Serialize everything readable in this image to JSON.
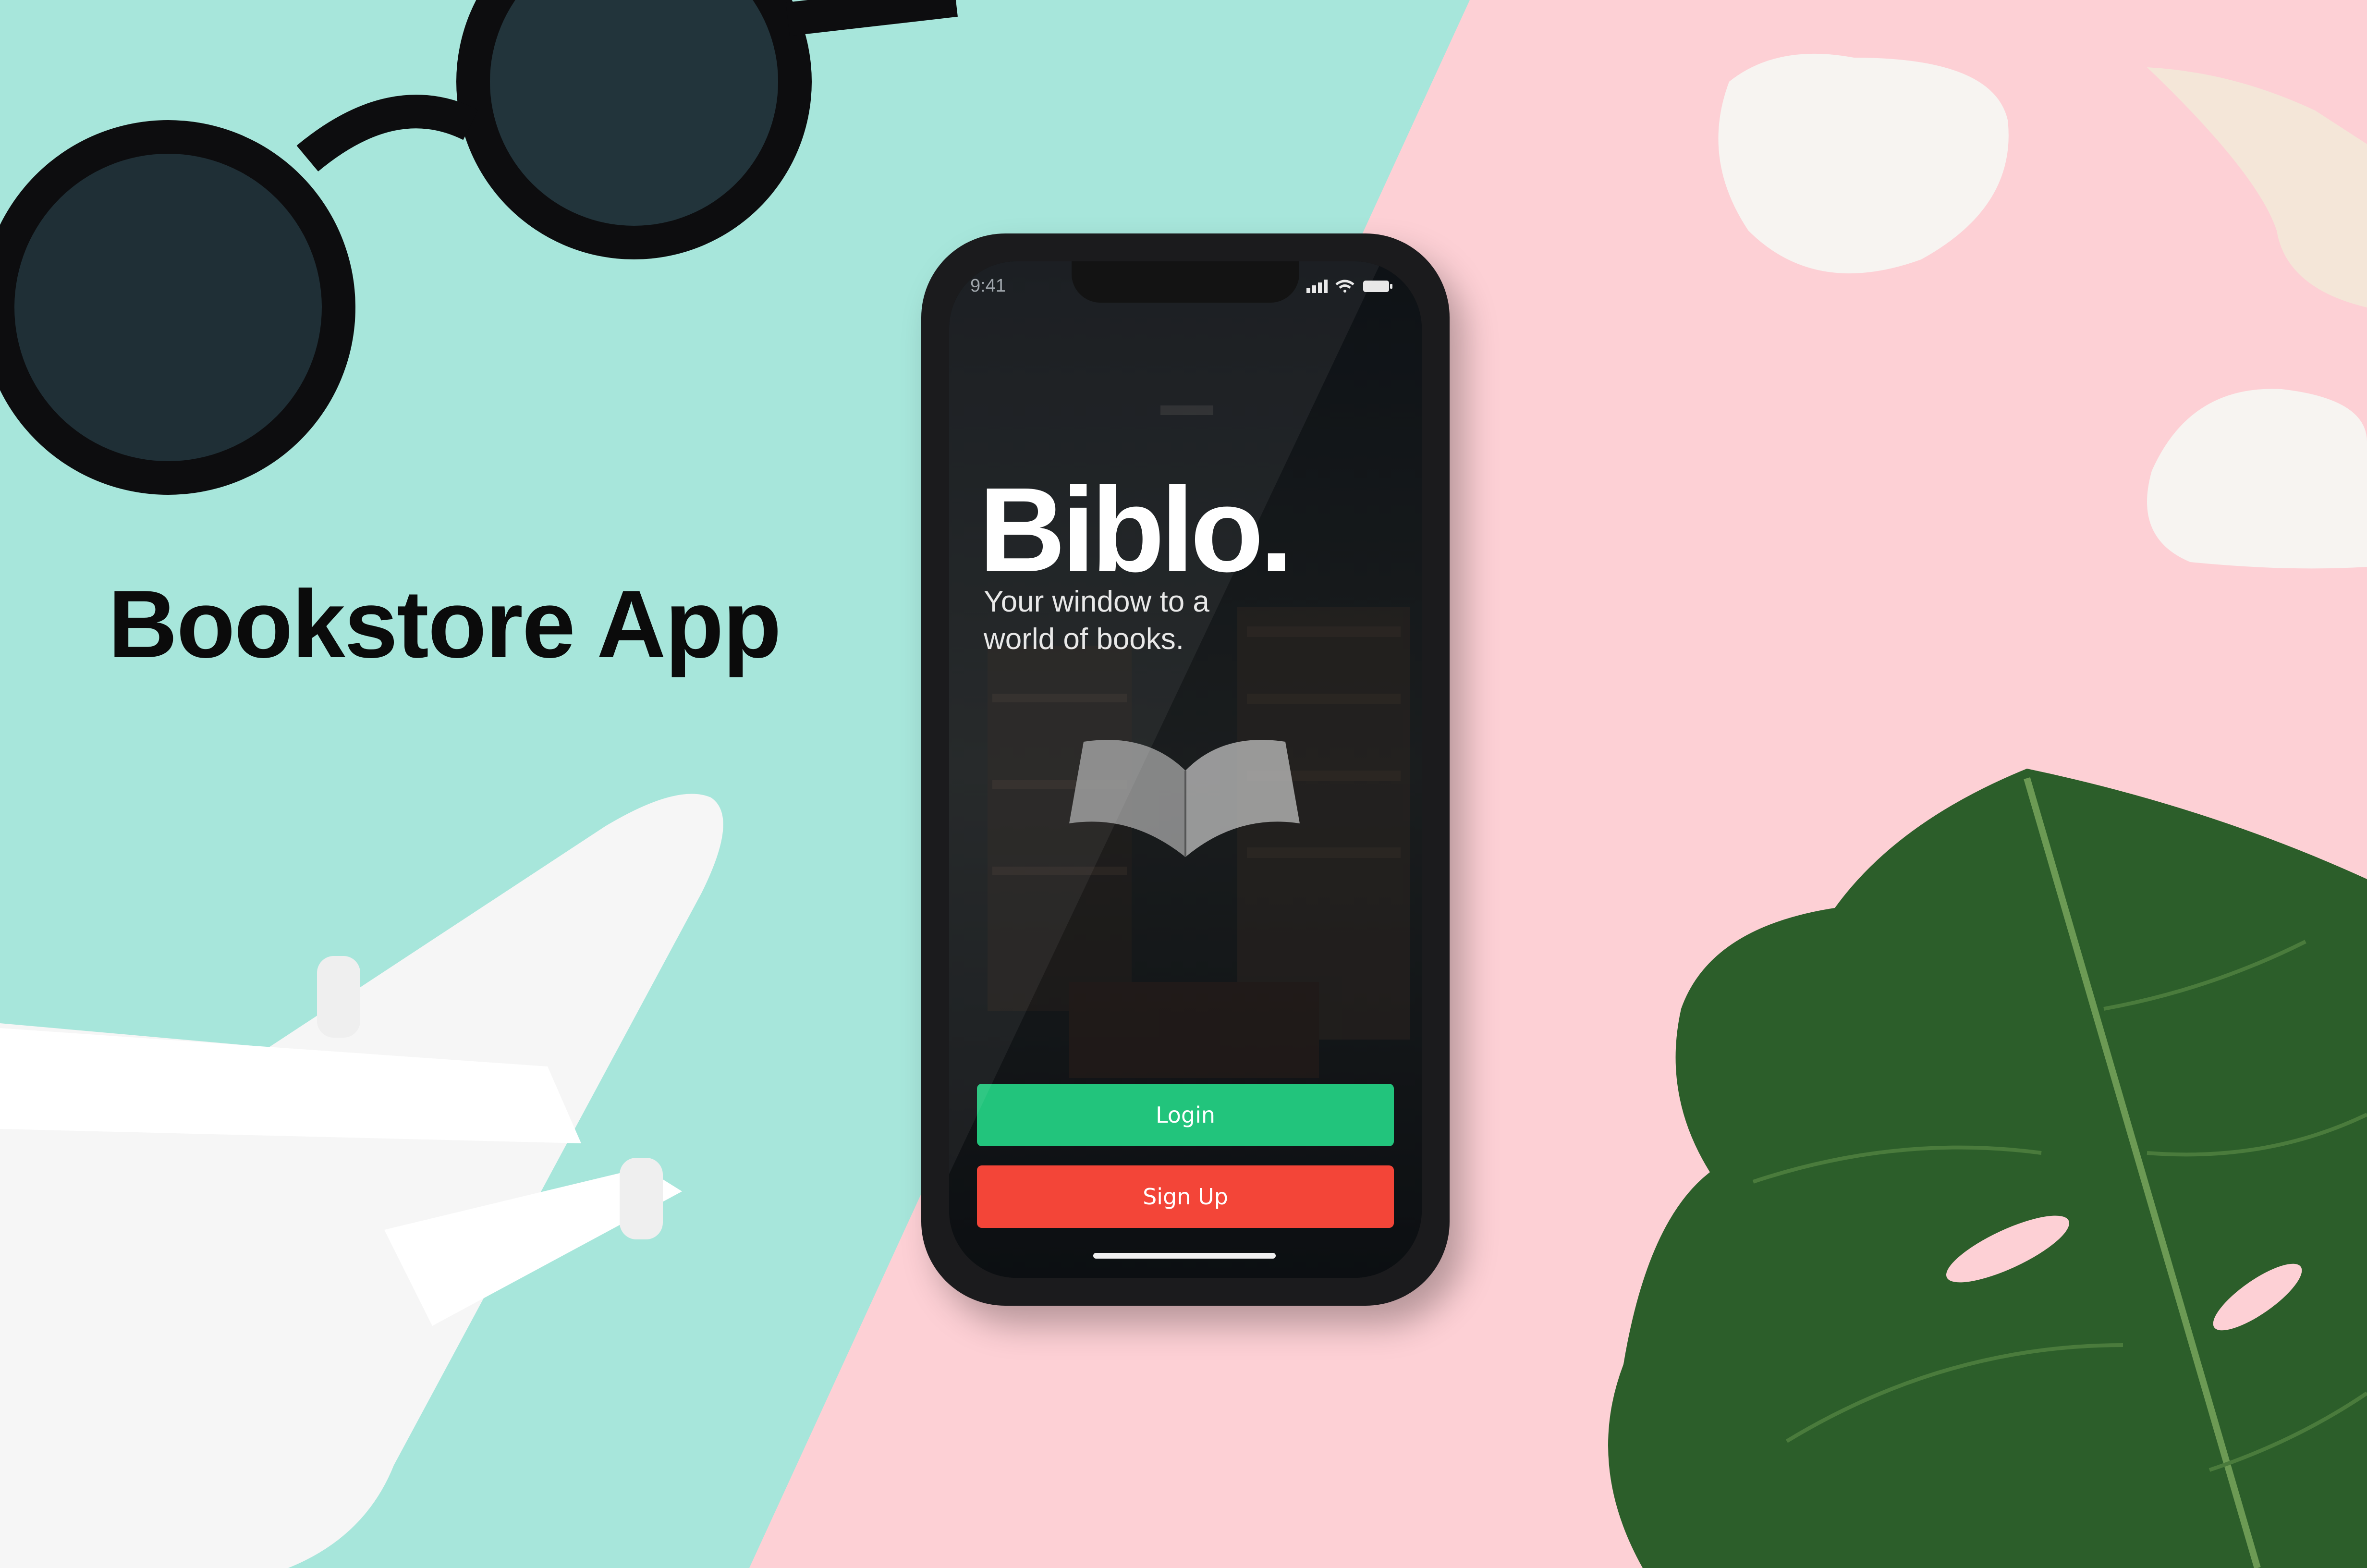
{
  "page": {
    "headline": "Bookstore App"
  },
  "app": {
    "status_time": "9:41",
    "brand_name": "Biblo.",
    "tagline": "Your window to a world of books.",
    "login_label": "Login",
    "signup_label": "Sign Up",
    "colors": {
      "login": "#22c47c",
      "signup": "#f34538",
      "screen_bg": "#0c0f12"
    }
  },
  "icons": [
    "signal-icon",
    "wifi-icon",
    "battery-icon",
    "open-book-icon"
  ],
  "scene": {
    "background_left": "#a6e6da",
    "background_right": "#fcd0d4",
    "props": [
      "sunglasses",
      "white-stone",
      "seashell",
      "toy-airplane",
      "monstera-leaf"
    ]
  }
}
